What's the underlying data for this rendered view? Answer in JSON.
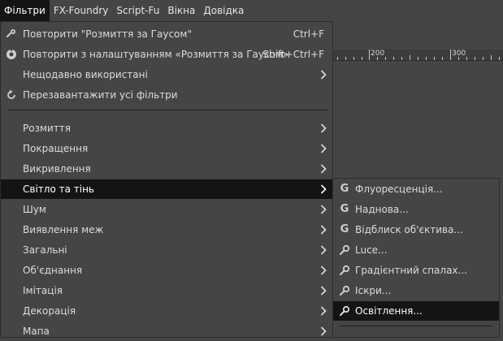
{
  "menubar": {
    "items": [
      {
        "label": "Фільтри",
        "active": true
      },
      {
        "label": "FX-Foundry"
      },
      {
        "label": "Script-Fu"
      },
      {
        "label": "Вікна"
      },
      {
        "label": "Довідка"
      }
    ]
  },
  "ruler": {
    "labels": [
      "200",
      "300"
    ]
  },
  "filters_menu": {
    "repeat": {
      "label": "Повторити \"Розмиття за Гаусом\"",
      "shortcut": "Ctrl+F",
      "icon": "repeat-icon"
    },
    "reshow": {
      "label": "Повторити з налаштуванням «Розмиття за Гаусом»",
      "shortcut": "Shift+Ctrl+F",
      "icon": "reshow-icon"
    },
    "recent": {
      "label": "Нещодавно використані"
    },
    "reset": {
      "label": "Перезавантажити усі фільтри",
      "icon": "reload-icon"
    },
    "categories": [
      {
        "label": "Розмиття"
      },
      {
        "label": "Покращення"
      },
      {
        "label": "Викривлення"
      },
      {
        "label": "Світло та тінь",
        "highlighted": true
      },
      {
        "label": "Шум"
      },
      {
        "label": "Виявлення меж"
      },
      {
        "label": "Загальні"
      },
      {
        "label": "Об'єднання"
      },
      {
        "label": "Імітація"
      },
      {
        "label": "Декорація"
      },
      {
        "label": "Мапа"
      }
    ]
  },
  "light_shadow_submenu": {
    "items": [
      {
        "label": "Флуоресценція...",
        "icon": "gegl-icon"
      },
      {
        "label": "Наднова...",
        "icon": "gegl-icon"
      },
      {
        "label": "Відблиск об'єктива...",
        "icon": "gegl-icon"
      },
      {
        "label": "Luce...",
        "icon": "gear-icon"
      },
      {
        "label": "Градієнтний спалах...",
        "icon": "gear-icon"
      },
      {
        "label": "Іскри...",
        "icon": "gear-icon"
      },
      {
        "label": "Освітлення...",
        "icon": "gear-icon",
        "highlighted": true
      }
    ]
  }
}
